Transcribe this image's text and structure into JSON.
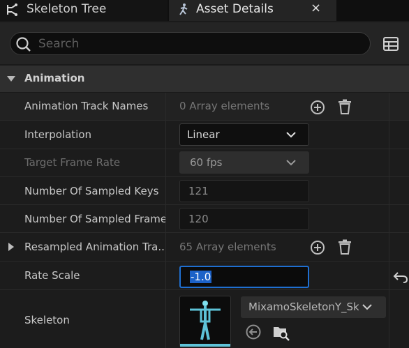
{
  "tabs": [
    {
      "label": "Skeleton Tree",
      "icon": "skeleton-tree-icon"
    },
    {
      "label": "Asset Details",
      "icon": "asset-details-icon",
      "close": "×"
    }
  ],
  "search": {
    "placeholder": "Search",
    "value": ""
  },
  "section": {
    "title": "Animation"
  },
  "rows": {
    "track_names": {
      "label": "Animation Track Names",
      "value": "0 Array elements"
    },
    "interpolation": {
      "label": "Interpolation",
      "value": "Linear"
    },
    "target_frame_rate": {
      "label": "Target Frame Rate",
      "value": "60 fps"
    },
    "sampled_keys": {
      "label": "Number Of Sampled Keys",
      "value": "121"
    },
    "sampled_frames": {
      "label": "Number Of Sampled Frames",
      "value": "120"
    },
    "resampled": {
      "label": "Resampled Animation Tra...",
      "value": "65 Array elements"
    },
    "rate_scale": {
      "label": "Rate Scale",
      "value": "-1.0"
    },
    "skeleton": {
      "label": "Skeleton",
      "value": "MixamoSkeletonY_Sk"
    }
  },
  "colors": {
    "accent": "#1f6fd1",
    "thumbnail_bar": "#5ec3d8"
  }
}
